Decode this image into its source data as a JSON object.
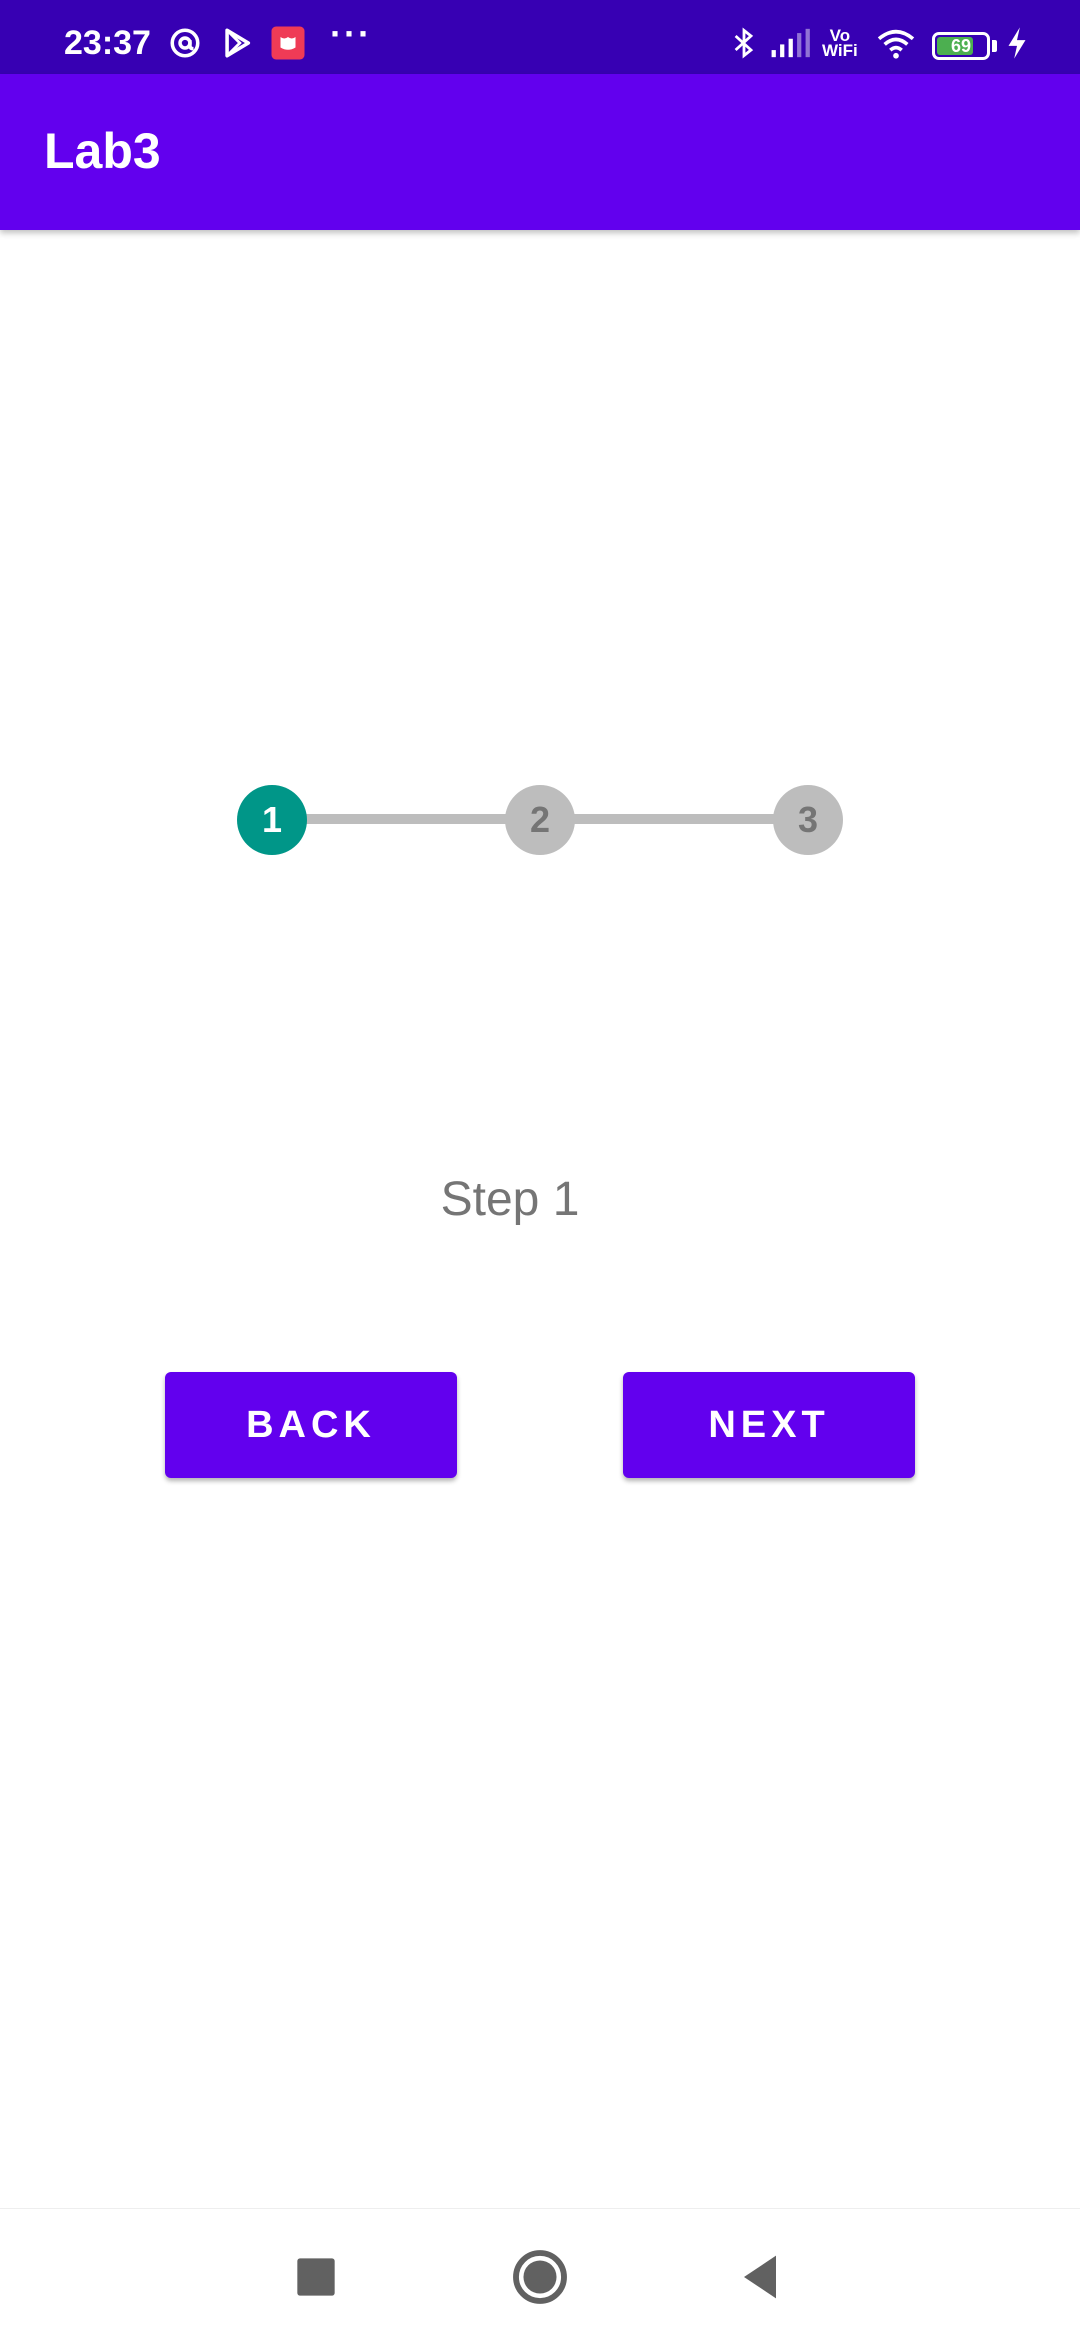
{
  "status_bar": {
    "time": "23:37",
    "battery_level": "69",
    "network_label_top": "Vo",
    "network_label_bottom": "WiFi",
    "icons": [
      "at-sign-icon",
      "play-store-icon",
      "app-notification-icon",
      "more-icon",
      "bluetooth-icon",
      "signal-icon",
      "vowifi-icon",
      "wifi-icon",
      "battery-icon",
      "charging-icon"
    ],
    "more": "···"
  },
  "app_bar": {
    "title": "Lab3"
  },
  "stepper": {
    "active_color": "#009688",
    "inactive_color": "#bdbdbd",
    "steps": [
      {
        "label": "1",
        "active": true
      },
      {
        "label": "2",
        "active": false
      },
      {
        "label": "3",
        "active": false
      }
    ]
  },
  "content": {
    "step_text": "Step 1",
    "back_label": "BACK",
    "next_label": "NEXT"
  },
  "theme": {
    "primary": "#6200ee",
    "primary_dark": "#3700b3"
  },
  "nav_bar": {
    "icons": [
      "recents-icon",
      "home-icon",
      "back-icon"
    ]
  }
}
